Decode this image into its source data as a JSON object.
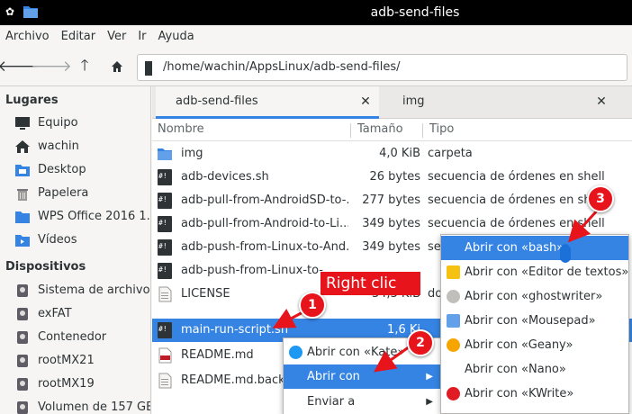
{
  "window": {
    "title": "adb-send-files"
  },
  "menubar": [
    "Archivo",
    "Editar",
    "Ver",
    "Ir",
    "Ayuda"
  ],
  "location": {
    "path": "/home/wachin/AppsLinux/adb-send-files/"
  },
  "sidebar": {
    "places_heading": "Lugares",
    "places": [
      {
        "label": "Equipo",
        "icon": "monitor-icon"
      },
      {
        "label": "wachin",
        "icon": "home-icon"
      },
      {
        "label": "Desktop",
        "icon": "desktop-folder-icon"
      },
      {
        "label": "Papelera",
        "icon": "trash-icon"
      },
      {
        "label": "WPS Office 2016 1...",
        "icon": "folder-icon"
      },
      {
        "label": "Vídeos",
        "icon": "videos-folder-icon"
      }
    ],
    "devices_heading": "Dispositivos",
    "devices": [
      {
        "label": "Sistema de archivos",
        "icon": "drive-icon"
      },
      {
        "label": "exFAT",
        "icon": "drive-icon"
      },
      {
        "label": "Contenedor",
        "icon": "drive-icon"
      },
      {
        "label": "rootMX21",
        "icon": "drive-icon"
      },
      {
        "label": "rootMX19",
        "icon": "drive-icon"
      },
      {
        "label": "Volumen de 157 GB",
        "icon": "drive-icon"
      }
    ]
  },
  "tabs": [
    {
      "label": "adb-send-files",
      "active": true
    },
    {
      "label": "img",
      "active": false
    }
  ],
  "columns": {
    "name": "Nombre",
    "size": "Tamaño",
    "type": "Tipo"
  },
  "files": [
    {
      "name": "img",
      "size": "4,0 KiB",
      "type": "carpeta",
      "icon": "folder-icon"
    },
    {
      "name": "adb-devices.sh",
      "size": "26 bytes",
      "type": "secuencia de órdenes en shell",
      "icon": "shell-script-icon"
    },
    {
      "name": "adb-pull-from-AndroidSD-to-...",
      "size": "277 bytes",
      "type": "secuencia de órdenes en shell",
      "icon": "shell-script-icon"
    },
    {
      "name": "adb-pull-from-Android-to-Li...",
      "size": "349 bytes",
      "type": "secuencia de órdenes en shell",
      "icon": "shell-script-icon"
    },
    {
      "name": "adb-push-from-Linux-to-And...",
      "size": "349 bytes",
      "type": "secuencia de órdenes en shell",
      "icon": "shell-script-icon"
    },
    {
      "name": "adb-push-from-Linux-to-",
      "size": "",
      "type": "",
      "icon": "shell-script-icon"
    },
    {
      "name": "LICENSE",
      "size": "34,3 KiB",
      "type": "do",
      "icon": "text-file-icon"
    },
    {
      "name": "main-run-script.sh",
      "size": "1,6 Ki",
      "type": "",
      "icon": "shell-script-icon",
      "selected": true
    },
    {
      "name": "README.md",
      "size": "",
      "type": "",
      "icon": "markdown-file-icon"
    },
    {
      "name": "README.md.backu",
      "size": "",
      "type": "",
      "icon": "text-file-icon"
    }
  ],
  "context_menu": [
    {
      "label": "Abrir con «Kate»",
      "icon": "kate-icon"
    },
    {
      "label": "Abrir con",
      "icon": "",
      "highlighted": true,
      "submenu": true
    },
    {
      "label": "Enviar a",
      "icon": "",
      "submenu": true
    }
  ],
  "submenu": [
    {
      "label": "Abrir con «bash»",
      "icon": "",
      "highlighted": true
    },
    {
      "label": "Abrir con «Editor de textos»",
      "icon": "text-editor-icon"
    },
    {
      "label": "Abrir con «ghostwriter»",
      "icon": "ghostwriter-icon"
    },
    {
      "label": "Abrir con «Mousepad»",
      "icon": "mousepad-icon"
    },
    {
      "label": "Abrir con «Geany»",
      "icon": "geany-icon"
    },
    {
      "label": "Abrir con «Nano»",
      "icon": ""
    },
    {
      "label": "Abrir con «KWrite»",
      "icon": "kwrite-icon"
    }
  ],
  "annotations": {
    "callout": "Right clic",
    "badges": [
      "1",
      "2",
      "3"
    ]
  },
  "colors": {
    "accent": "#3584e4",
    "annotation_red": "#e8141b"
  }
}
